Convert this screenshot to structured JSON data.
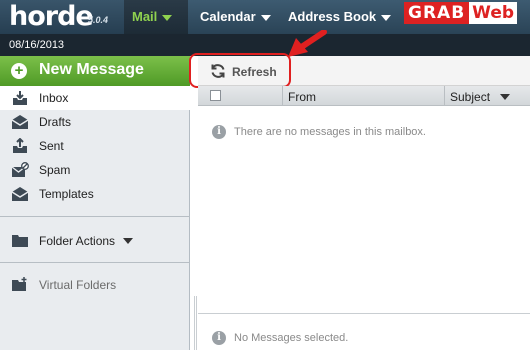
{
  "header": {
    "logo_text": "horde",
    "version": "5.0.4",
    "nav": [
      {
        "label": "Mail",
        "active": true
      },
      {
        "label": "Calendar",
        "active": false
      },
      {
        "label": "Address Book",
        "active": false
      }
    ],
    "watermark": {
      "part1": "GRAB",
      "part2": "Web"
    }
  },
  "date": "08/16/2013",
  "sidebar": {
    "new_message": "New Message",
    "folders": [
      {
        "label": "Inbox",
        "icon": "inbox-icon",
        "selected": true
      },
      {
        "label": "Drafts",
        "icon": "drafts-icon",
        "selected": false
      },
      {
        "label": "Sent",
        "icon": "sent-icon",
        "selected": false
      },
      {
        "label": "Spam",
        "icon": "spam-icon",
        "selected": false
      },
      {
        "label": "Templates",
        "icon": "templates-icon",
        "selected": false
      }
    ],
    "folder_actions": "Folder Actions",
    "virtual_folders": "Virtual Folders"
  },
  "toolbar": {
    "refresh_label": "Refresh"
  },
  "message_list": {
    "columns": [
      "From",
      "Subject"
    ],
    "empty_text": "There are no messages in this mailbox."
  },
  "preview": {
    "empty_text": "No Messages selected."
  },
  "colors": {
    "topbar": "#2f4a5e",
    "active_nav": "#8fd14f",
    "new_message_green": "#5fa832",
    "highlight_red": "#e02020"
  }
}
